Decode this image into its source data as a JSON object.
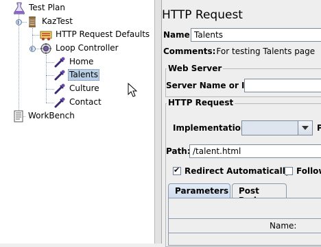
{
  "tree": {
    "test_plan": "Test Plan",
    "thread_group": "KazTest",
    "http_defaults": "HTTP Request Defaults",
    "loop_controller": "Loop Controller",
    "samplers": [
      "Home",
      "Talents",
      "Culture",
      "Contact"
    ],
    "selected": "Talents",
    "workbench": "WorkBench"
  },
  "panel": {
    "title": "HTTP Request",
    "name_label": "Name:",
    "name_value": "Talents",
    "comments_label": "Comments:",
    "comments_value": "For testing Talents page",
    "web_server_title": "Web Server",
    "server_label": "Server Name or IP:",
    "server_value": "",
    "http_request_title": "HTTP Request",
    "implementation_label": "Implementation:",
    "implementation_value": "",
    "protocol_cut_label": "P",
    "path_label": "Path:",
    "path_value": "/talent.html",
    "redirect_label": "Redirect Automatically",
    "redirect_checked": true,
    "follow_label": "Follow",
    "follow_checked": false,
    "tabs": [
      "Parameters",
      "Post Body"
    ],
    "active_tab": "Parameters",
    "table_header_name": "Name:"
  },
  "colors": {
    "selection": "#b8cfe5",
    "background": "#eeeeee"
  }
}
